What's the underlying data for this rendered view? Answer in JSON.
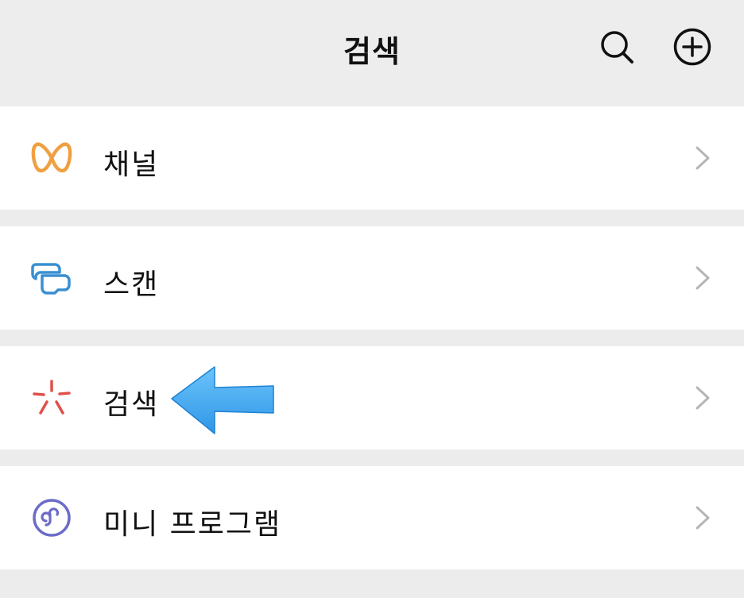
{
  "header": {
    "title": "검색",
    "actions": [
      {
        "icon": "search-icon"
      },
      {
        "icon": "plus-circle-icon"
      }
    ]
  },
  "menu": {
    "items": [
      {
        "label": "채널",
        "icon": "channels-icon",
        "icon_color": "#f0a040"
      },
      {
        "label": "스캔",
        "icon": "scan-icon",
        "icon_color": "#3a8fd1"
      },
      {
        "label": "검색",
        "icon": "search-sparkle-icon",
        "icon_color": "#e0504a"
      },
      {
        "label": "미니 프로그램",
        "icon": "mini-program-icon",
        "icon_color": "#6c6cc8"
      }
    ]
  },
  "annotation": {
    "icon": "blue-arrow-icon",
    "color": "#3aa8f0"
  },
  "colors": {
    "background": "#ececec",
    "row_background": "#ffffff",
    "chevron": "#b5b5b5"
  }
}
